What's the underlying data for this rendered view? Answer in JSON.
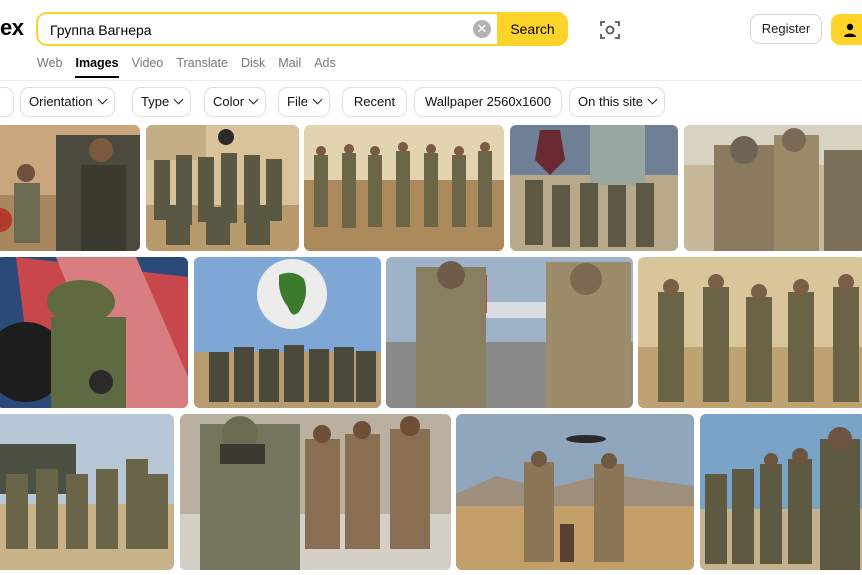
{
  "header": {
    "logo_fragment": "ex",
    "search_value": "Группа Вагнера",
    "search_button": "Search",
    "register_button": "Register"
  },
  "nav": [
    "Web",
    "Images",
    "Video",
    "Translate",
    "Disk",
    "Mail",
    "Ads"
  ],
  "filters": [
    "Orientation",
    "Type",
    "Color",
    "File",
    "Recent",
    "Wallpaper 2560x1600",
    "On this site"
  ],
  "images": [
    "wagner-fighters-group-photo-1",
    "wagner-fighters-desert-group",
    "wagner-fighters-desert-line",
    "wagner-fighters-with-emblem",
    "soldiers-in-gear-closeup",
    "soldier-with-flag",
    "wagner-group-with-africa-globe",
    "soldiers-airfield-plane",
    "soldiers-desert-group",
    "soldiers-armored-vehicle",
    "masked-soldier-running-group",
    "two-soldiers-helicopter-dog",
    "soldiers-column-rifles"
  ],
  "colors": {
    "accent": "#fed42b",
    "nav_active": "#000000",
    "nav_inactive": "#777777"
  }
}
